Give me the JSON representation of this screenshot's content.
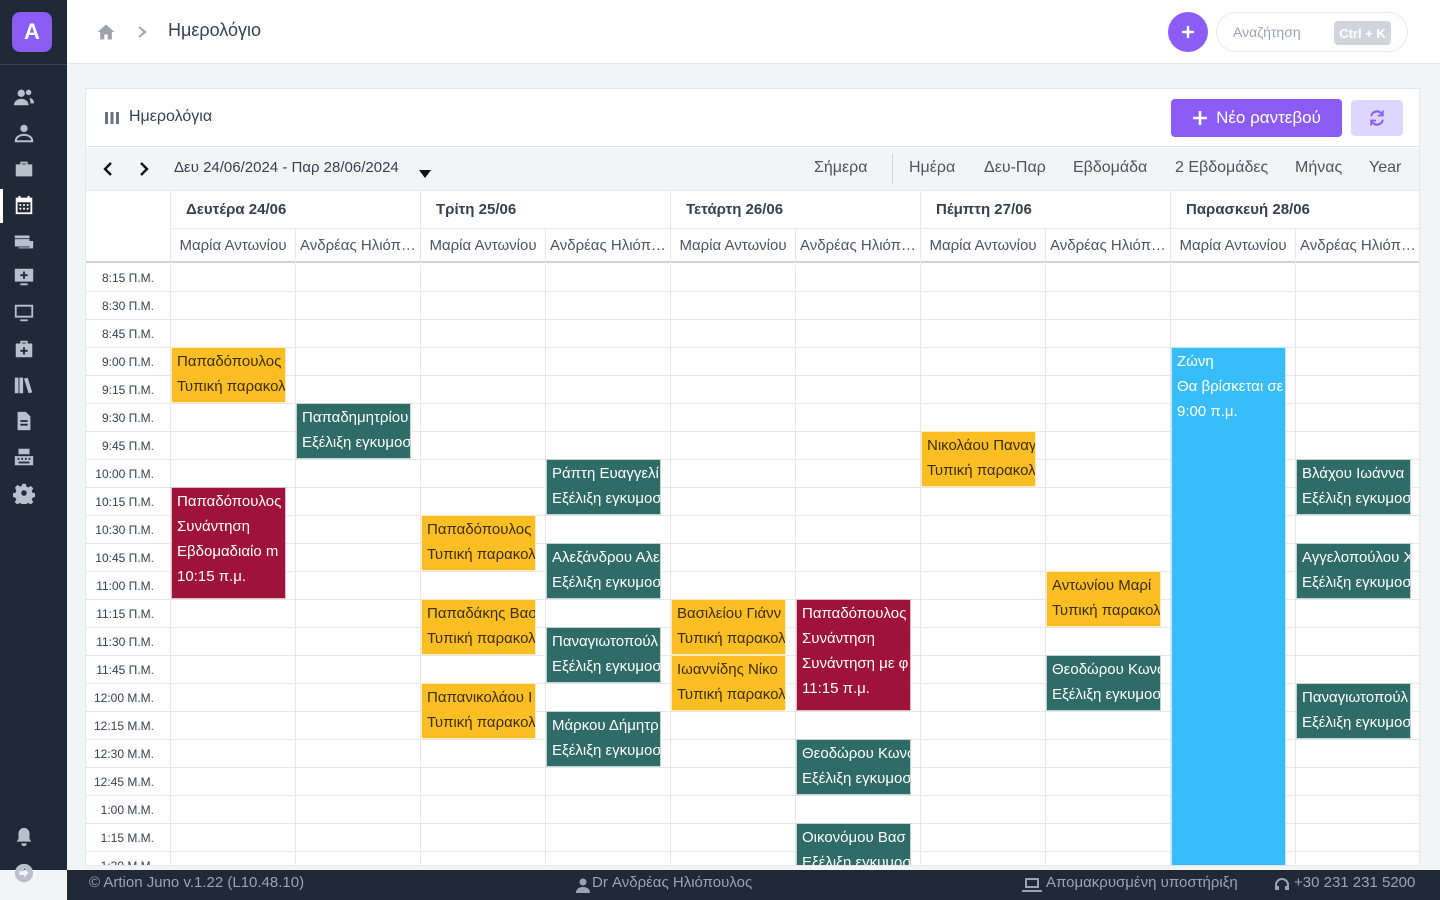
{
  "sidebar": {
    "logo_letter": "A",
    "items": [
      {
        "icon": "users-icon"
      },
      {
        "icon": "user-group-icon"
      },
      {
        "icon": "briefcase-icon"
      },
      {
        "icon": "calendar-icon"
      },
      {
        "icon": "money-check-icon"
      },
      {
        "icon": "desktop-add-icon"
      },
      {
        "icon": "desktop-icon"
      },
      {
        "icon": "medkit-icon"
      },
      {
        "icon": "books-icon"
      },
      {
        "icon": "file-icon"
      },
      {
        "icon": "keyboard-icon"
      },
      {
        "icon": "gear-icon"
      }
    ],
    "bottom": [
      {
        "icon": "bell-icon"
      },
      {
        "icon": "logout-icon"
      }
    ]
  },
  "topbar": {
    "page_title": "Ημερολόγιο",
    "search_placeholder": "Αναζήτηση",
    "search_shortcut": "Ctrl + K"
  },
  "panel": {
    "title": "Ημερολόγια",
    "new_button": "Νέο ραντεβού"
  },
  "toolbar": {
    "date_range": "Δευ 24/06/2024 - Παρ 28/06/2024",
    "views": [
      "Σήμερα",
      "Ημέρα",
      "Δευ-Παρ",
      "Εβδομάδα",
      "2 Εβδομάδες",
      "Μήνας",
      "Year"
    ]
  },
  "calendar": {
    "days": [
      "Δευτέρα 24/06",
      "Τρίτη 25/06",
      "Τετάρτη 26/06",
      "Πέμπτη 27/06",
      "Παρασκευή 28/06"
    ],
    "resources": [
      "Μαρία Αντωνίου",
      "Ανδρέας Ηλιόπουλος"
    ],
    "time_slots": [
      "8:15 Π.Μ.",
      "8:30 Π.Μ.",
      "8:45 Π.Μ.",
      "9:00 Π.Μ.",
      "9:15 Π.Μ.",
      "9:30 Π.Μ.",
      "9:45 Π.Μ.",
      "10:00 Π.Μ.",
      "10:15 Π.Μ.",
      "10:30 Π.Μ.",
      "10:45 Π.Μ.",
      "11:00 Π.Μ.",
      "11:15 Π.Μ.",
      "11:30 Π.Μ.",
      "11:45 Π.Μ.",
      "12:00 Μ.Μ.",
      "12:15 Μ.Μ.",
      "12:30 Μ.Μ.",
      "12:45 Μ.Μ.",
      "1:00 Μ.Μ.",
      "1:15 Μ.Μ.",
      "1:30 Μ.Μ."
    ],
    "events": [
      {
        "day": 0,
        "res": 0,
        "start": 3,
        "slots": 2,
        "color": "yellow",
        "lines": [
          "Παπαδόπουλος",
          "Τυπική παρακολ"
        ]
      },
      {
        "day": 0,
        "res": 1,
        "start": 5,
        "slots": 2,
        "color": "teal",
        "lines": [
          "Παπαδημητρίου",
          "Εξέλιξη εγκυμοσ"
        ]
      },
      {
        "day": 0,
        "res": 0,
        "start": 8,
        "slots": 4,
        "color": "crimson",
        "lines": [
          "Παπαδόπουλος",
          "Συνάντηση",
          "Εβδομαδιαίο m",
          "10:15 π.μ."
        ]
      },
      {
        "day": 1,
        "res": 0,
        "start": 9,
        "slots": 2,
        "color": "yellow",
        "lines": [
          "Παπαδόπουλος",
          "Τυπική παρακολ"
        ]
      },
      {
        "day": 1,
        "res": 1,
        "start": 7,
        "slots": 2,
        "color": "teal",
        "lines": [
          "Ράπτη Ευαγγελί",
          "Εξέλιξη εγκυμοσ"
        ]
      },
      {
        "day": 1,
        "res": 1,
        "start": 10,
        "slots": 2,
        "color": "teal",
        "lines": [
          "Αλεξάνδρου Αλε",
          "Εξέλιξη εγκυμοσ"
        ]
      },
      {
        "day": 1,
        "res": 0,
        "start": 12,
        "slots": 2,
        "color": "yellow",
        "lines": [
          "Παπαδάκης Βασ",
          "Τυπική παρακολ"
        ]
      },
      {
        "day": 1,
        "res": 1,
        "start": 13,
        "slots": 2,
        "color": "teal",
        "lines": [
          "Παναγιωτοπούλ",
          "Εξέλιξη εγκυμοσ"
        ]
      },
      {
        "day": 1,
        "res": 0,
        "start": 15,
        "slots": 2,
        "color": "yellow",
        "lines": [
          "Παπανικολάου Ι",
          "Τυπική παρακολ"
        ]
      },
      {
        "day": 1,
        "res": 1,
        "start": 16,
        "slots": 2,
        "color": "teal",
        "lines": [
          "Μάρκου Δήμητρ",
          "Εξέλιξη εγκυμοσ"
        ]
      },
      {
        "day": 2,
        "res": 0,
        "start": 12,
        "slots": 2,
        "color": "yellow",
        "lines": [
          "Βασιλείου Γιάνν",
          "Τυπική παρακολ"
        ]
      },
      {
        "day": 2,
        "res": 0,
        "start": 14,
        "slots": 2,
        "color": "yellow",
        "lines": [
          "Ιωαννίδης Νίκο",
          "Τυπική παρακολ"
        ]
      },
      {
        "day": 2,
        "res": 1,
        "start": 12,
        "slots": 4,
        "color": "crimson",
        "lines": [
          "Παπαδόπουλος",
          "Συνάντηση",
          "Συνάντηση με φ",
          "11:15 π.μ."
        ]
      },
      {
        "day": 2,
        "res": 1,
        "start": 17,
        "slots": 2,
        "color": "teal",
        "lines": [
          "Θεοδώρου Κωνσ",
          "Εξέλιξη εγκυμοσ"
        ]
      },
      {
        "day": 2,
        "res": 1,
        "start": 20,
        "slots": 2,
        "color": "teal",
        "lines": [
          "Οικονόμου Βασ",
          "Εξέλιξη εγκυμοσ"
        ]
      },
      {
        "day": 3,
        "res": 0,
        "start": 6,
        "slots": 2,
        "color": "yellow",
        "lines": [
          "Νικολάου Παναγ",
          "Τυπική παρακολ"
        ]
      },
      {
        "day": 3,
        "res": 1,
        "start": 11,
        "slots": 2,
        "color": "yellow",
        "lines": [
          "Αντωνίου Μαρί",
          "Τυπική παρακολ"
        ]
      },
      {
        "day": 3,
        "res": 1,
        "start": 14,
        "slots": 2,
        "color": "teal",
        "lines": [
          "Θεοδώρου Κωνσ",
          "Εξέλιξη εγκυμοσ"
        ]
      },
      {
        "day": 4,
        "res": 0,
        "start": 3,
        "slots": 19,
        "color": "blue",
        "lines": [
          " Ζώνη",
          "Θα βρίσκεται σε",
          "9:00 π.μ."
        ]
      },
      {
        "day": 4,
        "res": 1,
        "start": 7,
        "slots": 2,
        "color": "teal",
        "lines": [
          "Βλάχου Ιωάννα",
          "Εξέλιξη εγκυμοσ"
        ]
      },
      {
        "day": 4,
        "res": 1,
        "start": 10,
        "slots": 2,
        "color": "teal",
        "lines": [
          "Αγγελοπούλου Χ",
          "Εξέλιξη εγκυμοσ"
        ]
      },
      {
        "day": 4,
        "res": 1,
        "start": 15,
        "slots": 2,
        "color": "teal",
        "lines": [
          "Παναγιωτοπούλ",
          "Εξέλιξη εγκυμοσ"
        ]
      }
    ]
  },
  "footer": {
    "copyright": "© Artion Juno v.1.22 (L10.48.10)",
    "user": "Dr Ανδρέας Ηλιόπουλος",
    "remote_support": "Απομακρυσμένη υποστήριξη",
    "phone": "+30 231 231 5200"
  }
}
